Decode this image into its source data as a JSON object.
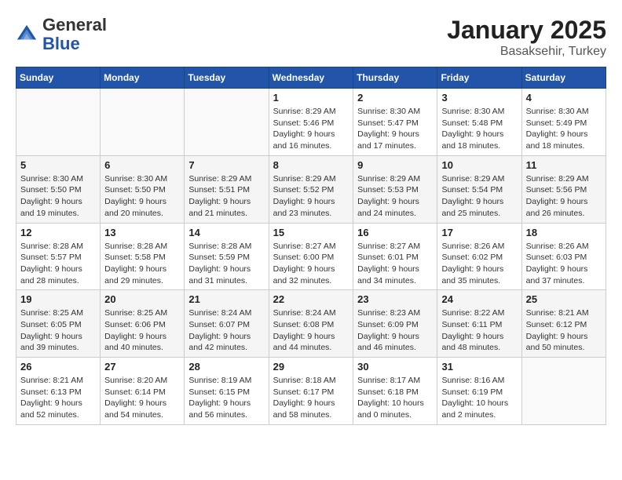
{
  "header": {
    "logo_general": "General",
    "logo_blue": "Blue",
    "month": "January 2025",
    "location": "Basaksehir, Turkey"
  },
  "days_of_week": [
    "Sunday",
    "Monday",
    "Tuesday",
    "Wednesday",
    "Thursday",
    "Friday",
    "Saturday"
  ],
  "weeks": [
    [
      {
        "day": "",
        "info": ""
      },
      {
        "day": "",
        "info": ""
      },
      {
        "day": "",
        "info": ""
      },
      {
        "day": "1",
        "info": "Sunrise: 8:29 AM\nSunset: 5:46 PM\nDaylight: 9 hours and 16 minutes."
      },
      {
        "day": "2",
        "info": "Sunrise: 8:30 AM\nSunset: 5:47 PM\nDaylight: 9 hours and 17 minutes."
      },
      {
        "day": "3",
        "info": "Sunrise: 8:30 AM\nSunset: 5:48 PM\nDaylight: 9 hours and 18 minutes."
      },
      {
        "day": "4",
        "info": "Sunrise: 8:30 AM\nSunset: 5:49 PM\nDaylight: 9 hours and 18 minutes."
      }
    ],
    [
      {
        "day": "5",
        "info": "Sunrise: 8:30 AM\nSunset: 5:50 PM\nDaylight: 9 hours and 19 minutes."
      },
      {
        "day": "6",
        "info": "Sunrise: 8:30 AM\nSunset: 5:50 PM\nDaylight: 9 hours and 20 minutes."
      },
      {
        "day": "7",
        "info": "Sunrise: 8:29 AM\nSunset: 5:51 PM\nDaylight: 9 hours and 21 minutes."
      },
      {
        "day": "8",
        "info": "Sunrise: 8:29 AM\nSunset: 5:52 PM\nDaylight: 9 hours and 23 minutes."
      },
      {
        "day": "9",
        "info": "Sunrise: 8:29 AM\nSunset: 5:53 PM\nDaylight: 9 hours and 24 minutes."
      },
      {
        "day": "10",
        "info": "Sunrise: 8:29 AM\nSunset: 5:54 PM\nDaylight: 9 hours and 25 minutes."
      },
      {
        "day": "11",
        "info": "Sunrise: 8:29 AM\nSunset: 5:56 PM\nDaylight: 9 hours and 26 minutes."
      }
    ],
    [
      {
        "day": "12",
        "info": "Sunrise: 8:28 AM\nSunset: 5:57 PM\nDaylight: 9 hours and 28 minutes."
      },
      {
        "day": "13",
        "info": "Sunrise: 8:28 AM\nSunset: 5:58 PM\nDaylight: 9 hours and 29 minutes."
      },
      {
        "day": "14",
        "info": "Sunrise: 8:28 AM\nSunset: 5:59 PM\nDaylight: 9 hours and 31 minutes."
      },
      {
        "day": "15",
        "info": "Sunrise: 8:27 AM\nSunset: 6:00 PM\nDaylight: 9 hours and 32 minutes."
      },
      {
        "day": "16",
        "info": "Sunrise: 8:27 AM\nSunset: 6:01 PM\nDaylight: 9 hours and 34 minutes."
      },
      {
        "day": "17",
        "info": "Sunrise: 8:26 AM\nSunset: 6:02 PM\nDaylight: 9 hours and 35 minutes."
      },
      {
        "day": "18",
        "info": "Sunrise: 8:26 AM\nSunset: 6:03 PM\nDaylight: 9 hours and 37 minutes."
      }
    ],
    [
      {
        "day": "19",
        "info": "Sunrise: 8:25 AM\nSunset: 6:05 PM\nDaylight: 9 hours and 39 minutes."
      },
      {
        "day": "20",
        "info": "Sunrise: 8:25 AM\nSunset: 6:06 PM\nDaylight: 9 hours and 40 minutes."
      },
      {
        "day": "21",
        "info": "Sunrise: 8:24 AM\nSunset: 6:07 PM\nDaylight: 9 hours and 42 minutes."
      },
      {
        "day": "22",
        "info": "Sunrise: 8:24 AM\nSunset: 6:08 PM\nDaylight: 9 hours and 44 minutes."
      },
      {
        "day": "23",
        "info": "Sunrise: 8:23 AM\nSunset: 6:09 PM\nDaylight: 9 hours and 46 minutes."
      },
      {
        "day": "24",
        "info": "Sunrise: 8:22 AM\nSunset: 6:11 PM\nDaylight: 9 hours and 48 minutes."
      },
      {
        "day": "25",
        "info": "Sunrise: 8:21 AM\nSunset: 6:12 PM\nDaylight: 9 hours and 50 minutes."
      }
    ],
    [
      {
        "day": "26",
        "info": "Sunrise: 8:21 AM\nSunset: 6:13 PM\nDaylight: 9 hours and 52 minutes."
      },
      {
        "day": "27",
        "info": "Sunrise: 8:20 AM\nSunset: 6:14 PM\nDaylight: 9 hours and 54 minutes."
      },
      {
        "day": "28",
        "info": "Sunrise: 8:19 AM\nSunset: 6:15 PM\nDaylight: 9 hours and 56 minutes."
      },
      {
        "day": "29",
        "info": "Sunrise: 8:18 AM\nSunset: 6:17 PM\nDaylight: 9 hours and 58 minutes."
      },
      {
        "day": "30",
        "info": "Sunrise: 8:17 AM\nSunset: 6:18 PM\nDaylight: 10 hours and 0 minutes."
      },
      {
        "day": "31",
        "info": "Sunrise: 8:16 AM\nSunset: 6:19 PM\nDaylight: 10 hours and 2 minutes."
      },
      {
        "day": "",
        "info": ""
      }
    ]
  ]
}
